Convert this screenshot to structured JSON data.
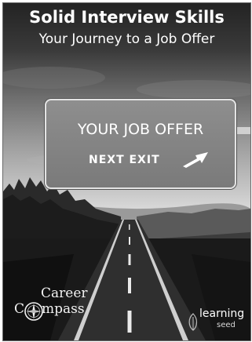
{
  "title": {
    "line1": "Solid Interview Skills",
    "line2": "Your Journey to a Job Offer"
  },
  "sign": {
    "line1": "YOUR JOB OFFER",
    "line2": "NEXT EXIT",
    "arrow_icon": "exit-arrow-icon"
  },
  "logos": {
    "left": {
      "line1": "Career",
      "line2_prefix": "C",
      "line2_rest": "mpass",
      "icon": "compass-icon"
    },
    "right": {
      "line1": "learning",
      "line2": "seed",
      "icon": "seed-leaf-icon"
    }
  },
  "colors": {
    "sky_dark": "#232323",
    "horizon": "#d8d8d8",
    "sign_fill": "#8e8e8e",
    "text": "#ffffff"
  }
}
